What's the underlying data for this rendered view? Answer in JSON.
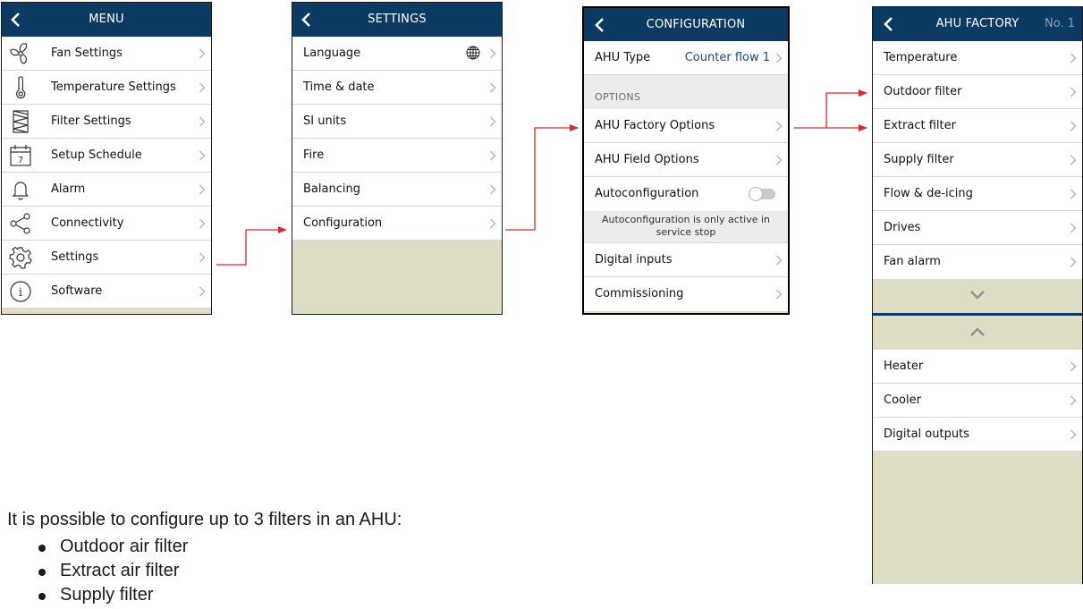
{
  "colors": {
    "header": "#0b3a63",
    "accent_value": "#114a86",
    "arrow": "#e0242a",
    "panel_bg": "#e0ddc5"
  },
  "menu": {
    "title": "MENU",
    "items": [
      {
        "label": "Fan Settings",
        "icon": "fan-icon"
      },
      {
        "label": "Temperature Settings",
        "icon": "thermometer-icon"
      },
      {
        "label": "Filter Settings",
        "icon": "filter-icon"
      },
      {
        "label": "Setup Schedule",
        "icon": "calendar-icon",
        "icon_text": "7"
      },
      {
        "label": "Alarm",
        "icon": "bell-icon"
      },
      {
        "label": "Connectivity",
        "icon": "share-icon"
      },
      {
        "label": "Settings",
        "icon": "gear-icon"
      },
      {
        "label": "Software",
        "icon": "info-icon",
        "icon_text": "i"
      }
    ]
  },
  "settings": {
    "title": "SETTINGS",
    "items": [
      {
        "label": "Language",
        "icon": "globe-icon"
      },
      {
        "label": "Time & date"
      },
      {
        "label": "SI units"
      },
      {
        "label": "Fire"
      },
      {
        "label": "Balancing"
      },
      {
        "label": "Configuration"
      }
    ]
  },
  "configuration": {
    "title": "CONFIGURATION",
    "ahu_type_label": "AHU Type",
    "ahu_type_value": "Counter flow 1",
    "options_header": "OPTIONS",
    "items": [
      {
        "label": "AHU Factory Options"
      },
      {
        "label": "AHU Field Options"
      }
    ],
    "autoconfig_label": "Autoconfiguration",
    "autoconfig_on": false,
    "autoconfig_note_1": "Autoconfiguration is only active in",
    "autoconfig_note_2": "service stop",
    "items2": [
      {
        "label": "Digital inputs"
      },
      {
        "label": "Commissioning"
      }
    ]
  },
  "ahu_factory": {
    "title": "AHU FACTORY",
    "number": "No. 1",
    "items": [
      {
        "label": "Temperature"
      },
      {
        "label": "Outdoor filter"
      },
      {
        "label": "Extract filter"
      },
      {
        "label": "Supply filter"
      },
      {
        "label": "Flow & de-icing"
      },
      {
        "label": "Drives"
      },
      {
        "label": "Fan alarm"
      }
    ],
    "items2": [
      {
        "label": "Heater"
      },
      {
        "label": "Cooler"
      },
      {
        "label": "Digital outputs"
      }
    ]
  },
  "caption": {
    "intro": "It is possible to configure up to 3 filters in an AHU:",
    "bullets": [
      "Outdoor air filter",
      "Extract air filter",
      "Supply filter"
    ]
  }
}
